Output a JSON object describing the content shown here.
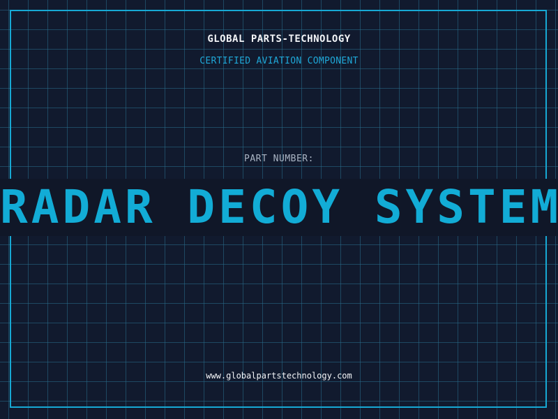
{
  "company": "GLOBAL PARTS-TECHNOLOGY",
  "subtitle": "CERTIFIED AVIATION COMPONENT",
  "part_label": "PART NUMBER:",
  "part_name": "RADAR DECOY SYSTEM",
  "website": "www.globalpartstechnology.com",
  "colors": {
    "background": "#111a2e",
    "grid": "#286e8c",
    "accent": "#12acd6",
    "text": "#f2f4f7"
  }
}
